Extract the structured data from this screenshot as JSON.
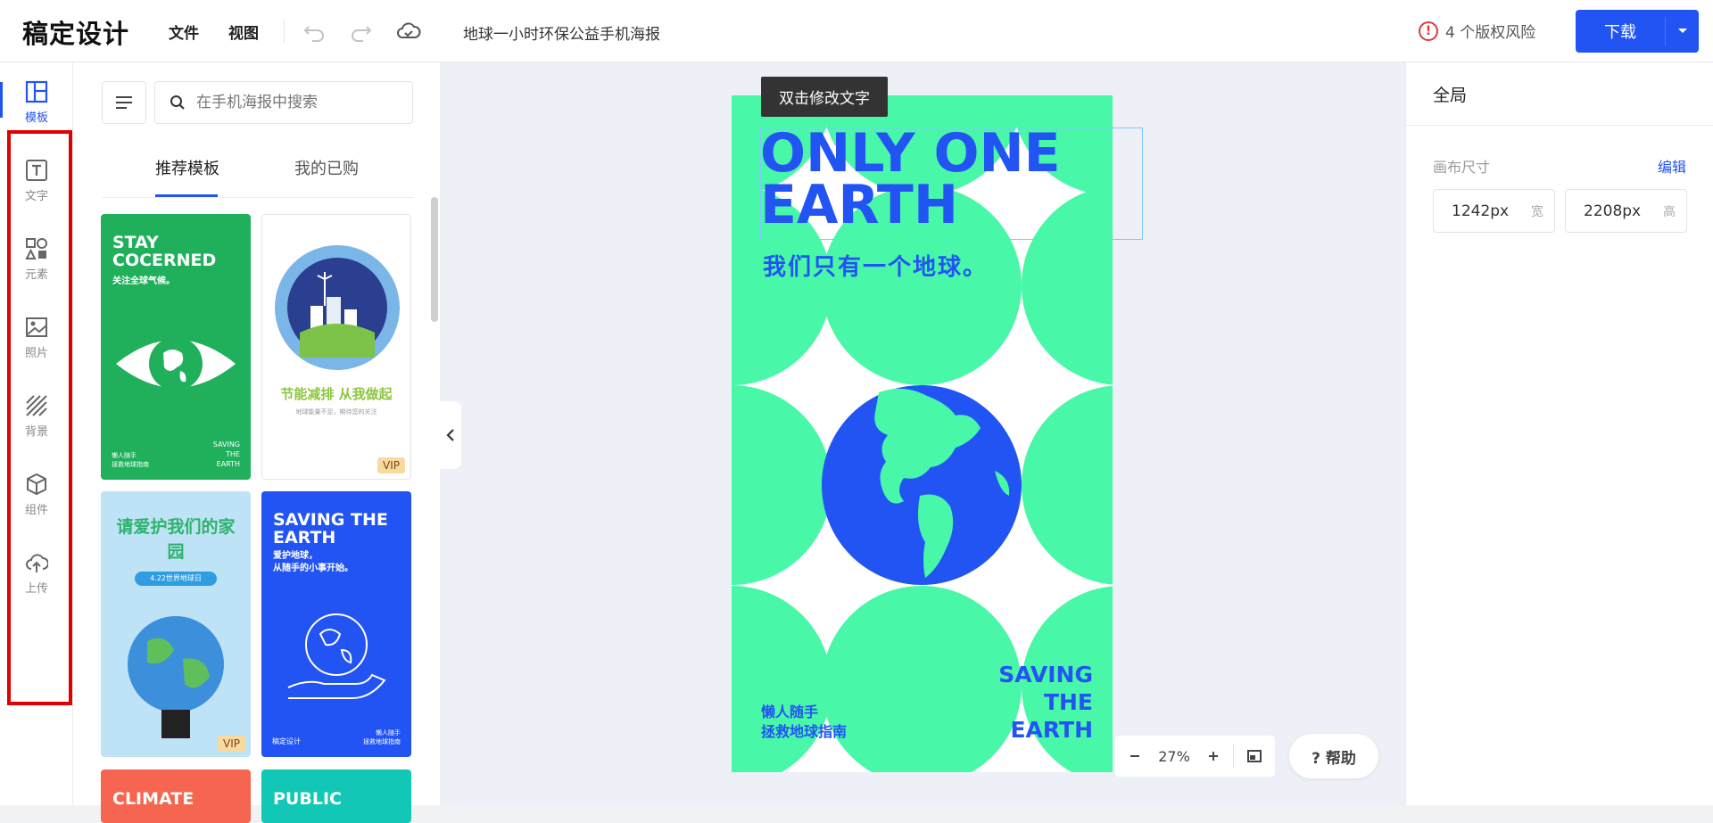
{
  "app": {
    "logo": "稿定设计",
    "doc_title": "地球一小时环保公益手机海报"
  },
  "menu": {
    "file": "文件",
    "view": "视图"
  },
  "header": {
    "risk_text": "4 个版权风险",
    "download_label": "下载"
  },
  "rail": [
    {
      "label": "模板",
      "icon": "template-icon",
      "active": true
    },
    {
      "label": "文字",
      "icon": "text-icon"
    },
    {
      "label": "元素",
      "icon": "elements-icon"
    },
    {
      "label": "照片",
      "icon": "photo-icon"
    },
    {
      "label": "背景",
      "icon": "background-icon"
    },
    {
      "label": "组件",
      "icon": "component-icon"
    },
    {
      "label": "上传",
      "icon": "upload-icon"
    }
  ],
  "panel": {
    "search_placeholder": "在手机海报中搜索",
    "tabs": [
      "推荐模板",
      "我的已购"
    ],
    "templates": [
      {
        "title": "STAY COCERNED",
        "subtitle": "关注全球气候。",
        "footer_left": "懒人随手\n拯救地球指南",
        "footer_right": "SAVING\nTHE\nEARTH",
        "bg": "#20b05c",
        "vip": false
      },
      {
        "title": "节能减排 从我做起",
        "subtitle": "地球能量不足，期待您的关注",
        "bg": "#ffffff",
        "vip": true,
        "vip_label": "VIP"
      },
      {
        "title": "请爱护我们的家园",
        "subtitle": "4.22世界地球日",
        "bg": "#bfe3f6",
        "vip": true,
        "vip_label": "VIP"
      },
      {
        "title": "SAVING THE EARTH",
        "subtitle": "爱护地球，\n从随手的小事开始。",
        "footer_left": "稿定设计",
        "footer_right": "懒人随手\n拯救地球指南",
        "bg": "#2254f4",
        "vip": false
      },
      {
        "title": "CLIMATE",
        "bg": "#f5654f"
      },
      {
        "title": "PUBLIC",
        "bg": "#12c7b5"
      }
    ]
  },
  "canvas": {
    "tooltip": "双击修改文字",
    "poster": {
      "title_line1": "ONLY ONE",
      "title_line2": "EARTH",
      "subtitle": "我们只有一个地球。",
      "bottom_left_1": "懒人随手",
      "bottom_left_2": "拯救地球指南",
      "save_1": "SAVING",
      "save_2": "THE",
      "save_3": "EARTH"
    },
    "zoom": "27%",
    "help": "? 帮助"
  },
  "right_panel": {
    "title": "全局",
    "canvas_size_label": "画布尺寸",
    "edit_label": "编辑",
    "width_value": "1242px",
    "width_unit": "宽",
    "height_value": "2208px",
    "height_unit": "高"
  },
  "colors": {
    "accent": "#2254f4",
    "poster_green": "#48f7a7",
    "risk_red": "#e03b3b"
  }
}
